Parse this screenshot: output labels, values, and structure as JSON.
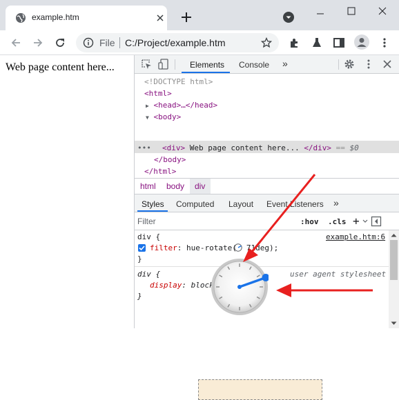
{
  "browser": {
    "tab_title": "example.htm",
    "omnibox": {
      "scheme_label": "File",
      "url": "C:/Project/example.htm"
    },
    "icons": [
      "globe-icon",
      "close-icon",
      "plus-icon",
      "tab-search-icon",
      "minimize-icon",
      "maximize-icon",
      "window-close-icon",
      "back-icon",
      "forward-icon",
      "reload-icon",
      "info-icon",
      "star-icon",
      "extensions-icon",
      "labs-icon",
      "sidepanel-icon",
      "avatar-icon",
      "kebab-menu-icon"
    ]
  },
  "page": {
    "content_text": "Web page content here..."
  },
  "devtools": {
    "tabs": {
      "elements": "Elements",
      "console": "Console",
      "more": "»"
    },
    "tree": {
      "doctype": "<!DOCTYPE html>",
      "html_open": "<html>",
      "head": "<head>…</head>",
      "body_open": "<body>",
      "dots": "•••",
      "div_open": "<div>",
      "div_text": " Web page content here... ",
      "div_close": "</div>",
      "div_eq": " == ",
      "div_var": "$0",
      "body_close": "</body>",
      "html_close": "</html>"
    },
    "breadcrumbs": [
      "html",
      "body",
      "div"
    ],
    "styles_tabs": {
      "styles": "Styles",
      "computed": "Computed",
      "layout": "Layout",
      "event_listeners": "Event Listeners",
      "more": "»"
    },
    "filter": {
      "placeholder": "Filter",
      "hov": ":hov",
      "cls": ".cls",
      "plus": "+"
    },
    "rules": {
      "rule1": {
        "selector": "div {",
        "source": "example.htm:6",
        "prop": "filter",
        "colon": ": ",
        "value_prefix": "hue-rotate(",
        "value_angle": "71deg",
        "value_suffix": ");",
        "close": "}"
      },
      "rule2": {
        "selector": "div {",
        "source": "user agent stylesheet",
        "prop": "display",
        "colon": ": ",
        "value": "block",
        "close": "}"
      }
    }
  },
  "colors": {
    "accent_blue": "#1a73e8",
    "arrow_red": "#e8201f",
    "prop_name": "#c80000",
    "tag_purple": "#881280"
  }
}
